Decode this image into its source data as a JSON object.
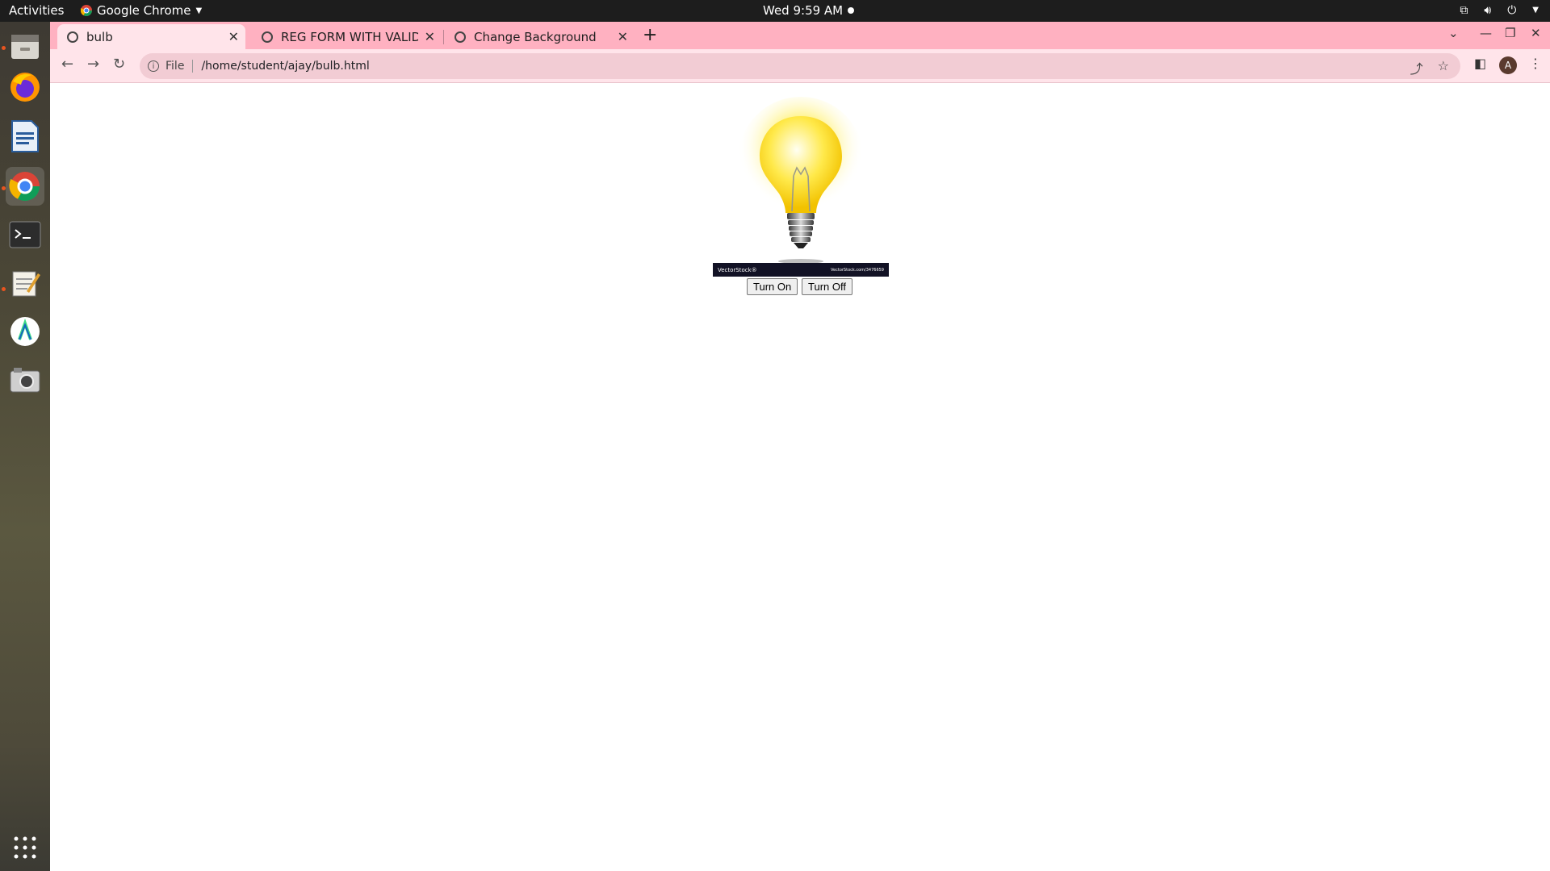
{
  "topbar": {
    "activities": "Activities",
    "app_name": "Google Chrome",
    "clock": "Wed  9:59 AM"
  },
  "dock": {
    "items": [
      "files-icon",
      "firefox-icon",
      "writer-icon",
      "chrome-icon",
      "terminal-icon",
      "text-editor-icon",
      "android-studio-icon",
      "camera-icon",
      "show-apps-icon"
    ]
  },
  "browser": {
    "tabs": [
      {
        "title": "bulb",
        "active": true
      },
      {
        "title": "REG FORM WITH VALIDAT",
        "active": false
      },
      {
        "title": "Change Background",
        "active": false
      }
    ],
    "address": {
      "scheme": "File",
      "url": "/home/student/ajay/bulb.html"
    },
    "profile_initial": "A"
  },
  "page": {
    "bulb_state": "on",
    "watermark_left": "VectorStock®",
    "watermark_right": "VectorStock.com/3476659",
    "turn_on_label": "Turn On",
    "turn_off_label": "Turn Off"
  },
  "colors": {
    "tabstrip": "#ffb1c1",
    "toolbar": "#ffe4ea",
    "omnibox": "#f2ccd4",
    "bulb_glow": "#fff176"
  }
}
